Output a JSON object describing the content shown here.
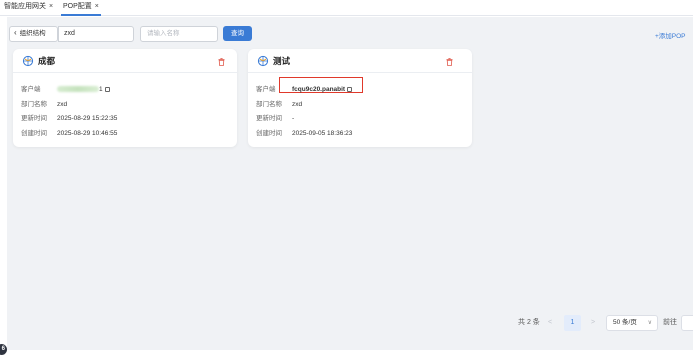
{
  "tabs": [
    {
      "label": "智能应用网关",
      "close": "×"
    },
    {
      "label": "POP配置",
      "close": "×"
    }
  ],
  "toolbar": {
    "back_label": "组织结构",
    "org_value": "zxd",
    "name_placeholder": "请输入名称",
    "query_label": "查询",
    "add_label": "+添加POP"
  },
  "cards": [
    {
      "title": "成都",
      "rows": [
        {
          "label": "客户端",
          "value": "1"
        },
        {
          "label": "部门名称",
          "value": "zxd"
        },
        {
          "label": "更新时间",
          "value": "2025-08-29 15:22:35"
        },
        {
          "label": "创建时间",
          "value": "2025-08-29 10:46:55"
        }
      ]
    },
    {
      "title": "测试",
      "rows": [
        {
          "label": "客户端",
          "value": "fcqu9c20.panabit"
        },
        {
          "label": "部门名称",
          "value": "zxd"
        },
        {
          "label": "更新时间",
          "value": "-"
        },
        {
          "label": "创建时间",
          "value": "2025-09-05 18:36:23"
        }
      ]
    }
  ],
  "pagination": {
    "total": "共 2 条",
    "prev": "<",
    "current": "1",
    "next": ">",
    "page_size": "50 条/页",
    "goto": "前往"
  },
  "colors": {
    "accent": "#3a7bd5",
    "highlight_border": "#e0392b",
    "domain_text": "#3c9a26",
    "delete_icon": "#e05a4c"
  },
  "corner_badge": "6"
}
